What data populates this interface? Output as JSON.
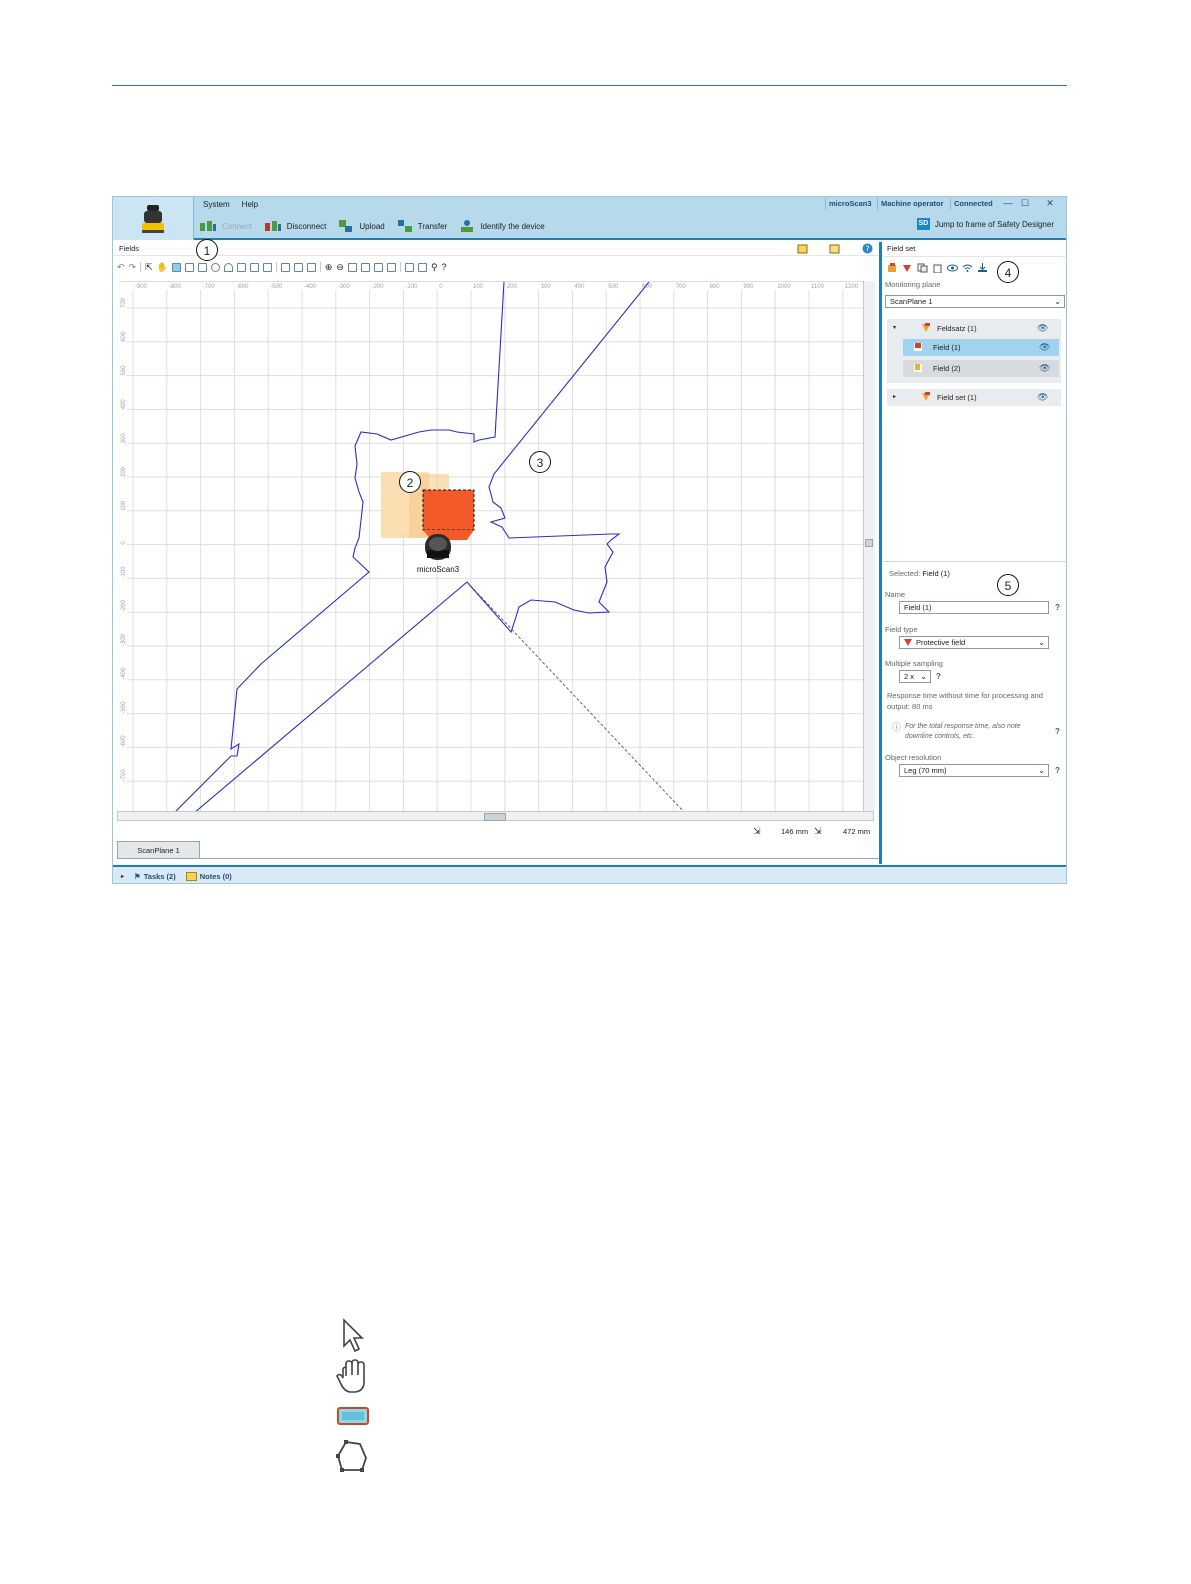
{
  "menu": {
    "system": "System",
    "help": "Help"
  },
  "status": {
    "device": "microScan3",
    "user": "Machine operator",
    "connection": "Connected"
  },
  "window": {
    "minimize": "—",
    "maximize": "☐",
    "close": "✕"
  },
  "ribbon": {
    "connect": "Connect",
    "disconnect": "Disconnect",
    "upload": "Upload",
    "transfer": "Transfer",
    "identify": "Identify the device",
    "jump": "Jump to frame of Safety Designer",
    "sd_icon": "SD"
  },
  "fields_pane": {
    "title": "Fields",
    "device_label": "microScan3",
    "x_ticks": [
      "-900",
      "-800",
      "-700",
      "-600",
      "-500",
      "-400",
      "-300",
      "-200",
      "-100",
      "0",
      "100",
      "200",
      "300",
      "400",
      "500",
      "600",
      "700",
      "800",
      "900",
      "1000",
      "1100",
      "1200"
    ],
    "y_ticks": [
      "700",
      "600",
      "500",
      "400",
      "300",
      "200",
      "100",
      "0",
      "-100",
      "-200",
      "-300",
      "-400",
      "-500",
      "-600",
      "-700"
    ],
    "measure_1": "146 mm",
    "measure_2": "472 mm",
    "tab": "ScanPlane 1"
  },
  "bottom": {
    "tasks": "Tasks (2)",
    "notes": "Notes (0)"
  },
  "right_panel": {
    "title": "Field set",
    "monitoring_plane_label": "Monitoring plane",
    "monitoring_plane_value": "ScanPlane 1",
    "tree": [
      {
        "label": "Feldsatz (1)"
      },
      {
        "label": "Field (1)"
      },
      {
        "label": "Field (2)"
      },
      {
        "label": "Field set (1)"
      }
    ],
    "selected_prefix": "Selected:",
    "selected_value": "Field (1)",
    "name_label": "Name",
    "name_value": "Field (1)",
    "field_type_label": "Field type",
    "field_type_value": "Protective field",
    "multiple_sampling_label": "Multiple sampling",
    "multiple_sampling_value": "2 x",
    "response_time_text": "Response time without time for processing and output: 80 ms",
    "note_text": "For the total response time, also note downline controls, etc.",
    "object_resolution_label": "Object resolution",
    "object_resolution_value": "Leg (70 mm)"
  },
  "callouts": [
    "1",
    "2",
    "3",
    "4",
    "5"
  ],
  "colors": {
    "accent": "#1e7fb6",
    "protective_field": "#f25a2a",
    "warning_field": "#f9d9a8",
    "contour": "#2b2fbf",
    "selected_row": "#9fd3ee"
  },
  "legend_icons": [
    "pointer-icon",
    "hand-pan-icon",
    "edit-field-icon",
    "polygon-icon"
  ]
}
